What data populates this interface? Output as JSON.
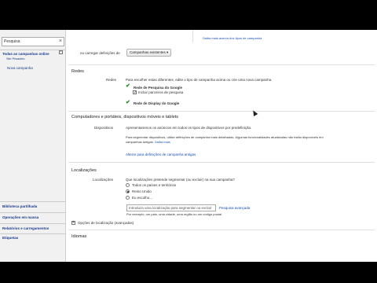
{
  "sidebar": {
    "search_placeholder": "Pesquisa",
    "items": [
      {
        "label": "Todas as campanhas online"
      },
      {
        "label": "Site Pesadelo"
      },
      {
        "label": "Nova campanha"
      }
    ],
    "bottom_items": [
      {
        "label": "Biblioteca partilhada"
      },
      {
        "label": "Operações em massa"
      },
      {
        "label": "Relatórios e carregamentos"
      },
      {
        "label": "Etiquetas"
      }
    ]
  },
  "header_right_link": "Saiba mais acerca dos tipos de campanha",
  "load_settings": {
    "label": "ou carregar definições de",
    "button": "Campanhas existentes"
  },
  "redes": {
    "section_title": "Redes",
    "label": "Redes",
    "intro": "Para escolher estas diferentes, edite o tipo de campanha acima ou crie uma nova campanha.",
    "search_network": "Rede de Pesquisa do Google",
    "search_partners": "Incluir parceiros de pesquisa",
    "display_network": "Rede de Display do Google"
  },
  "devices": {
    "section_title": "Computadores e portáteis, dispositivos móveis e tablets",
    "label": "Dispositivos",
    "line1": "Apresentaremos os anúncios em todos os tipos de dispositivos por predefinição.",
    "line2": "Para segmentar dispositivos, utilize definições de campanha mais detalhadas. Algumas funcionalidades atualizadas não estão disponíveis em",
    "line3": "campanhas antigas.",
    "learn_more": "Saiba mais",
    "change_link": "Alterar para definições de campanha antigas"
  },
  "locations": {
    "section_title": "Localizações",
    "label": "Localizações",
    "question": "Que localizações pretende segmentar (ou excluir) na sua campanha?",
    "option1": "Todos os países e territórios",
    "option2": "Reino Unido",
    "option3": "Eu escolho...",
    "input_placeholder": "Introduza uma localização para segmentar ou excluir",
    "advanced_link": "Pesquisa avançada",
    "hint": "Por exemplo, um país, uma cidade, uma região ou um código postal",
    "options_link": "Opções de localização (avançadas)"
  },
  "idiomas": {
    "section_title": "Idiomas"
  }
}
